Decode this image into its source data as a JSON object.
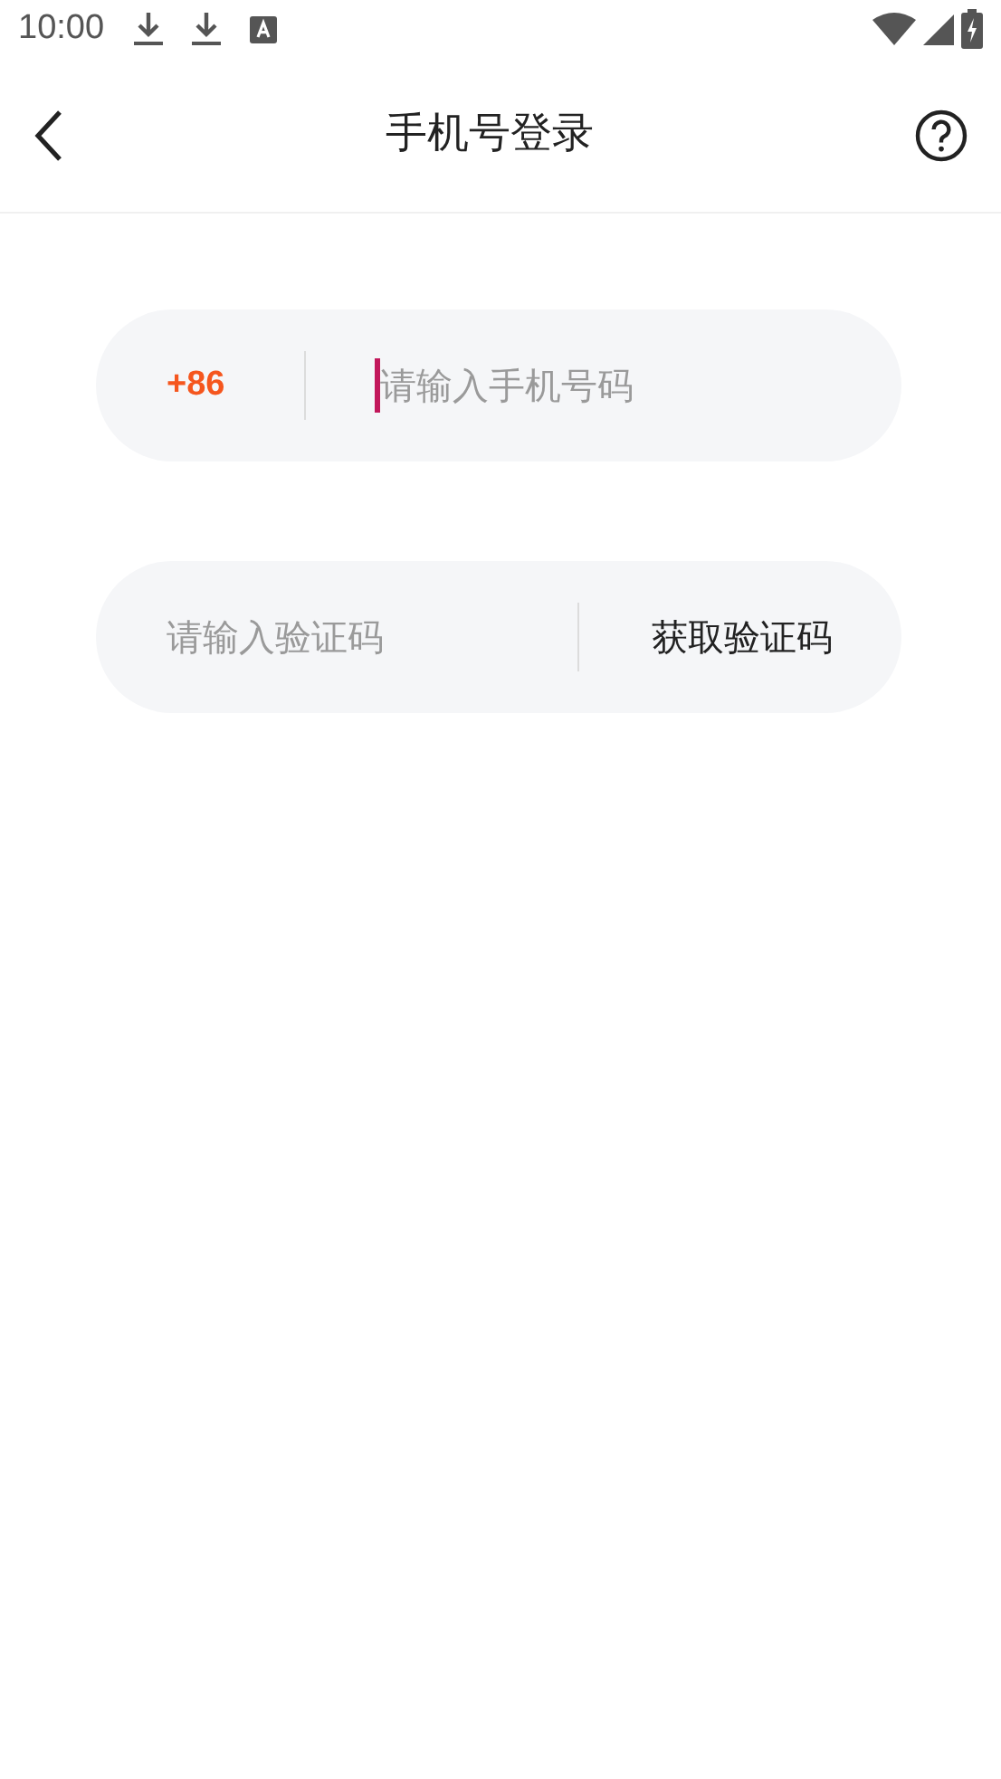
{
  "status_bar": {
    "time": "10:00"
  },
  "header": {
    "title": "手机号登录"
  },
  "phone_field": {
    "country_code": "+86",
    "placeholder": "请输入手机号码",
    "focused": true
  },
  "code_field": {
    "placeholder": "请输入验证码",
    "get_code_button": "获取验证码"
  }
}
